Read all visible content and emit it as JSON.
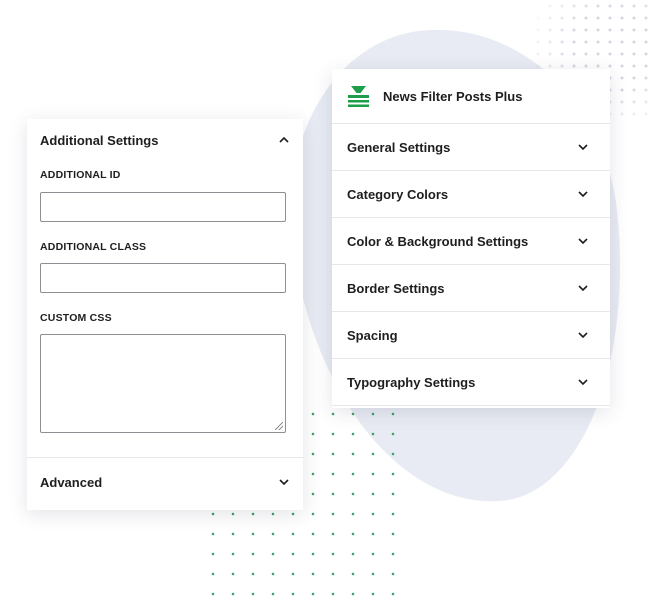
{
  "left_panel": {
    "title": "Additional Settings",
    "fields": {
      "id_label": "ADDITIONAL ID",
      "class_label": "ADDITIONAL CLASS",
      "css_label": "CUSTOM CSS",
      "id_value": "",
      "class_value": "",
      "css_value": ""
    },
    "advanced_label": "Advanced"
  },
  "right_panel": {
    "plugin_name": "News Filter Posts Plus",
    "items": [
      {
        "label": "General Settings"
      },
      {
        "label": "Category Colors"
      },
      {
        "label": "Color & Background Settings"
      },
      {
        "label": "Border Settings"
      },
      {
        "label": "Spacing"
      },
      {
        "label": "Typography Settings"
      }
    ]
  },
  "colors": {
    "brand_green": "#1e9e4a",
    "panel_bg": "#ffffff",
    "blob": "#e8ebf3",
    "border": "#8c8f94"
  },
  "icons": {
    "brand": "filter-funnel-icon",
    "expand": "chevron-down-icon",
    "collapse": "chevron-up-icon"
  }
}
